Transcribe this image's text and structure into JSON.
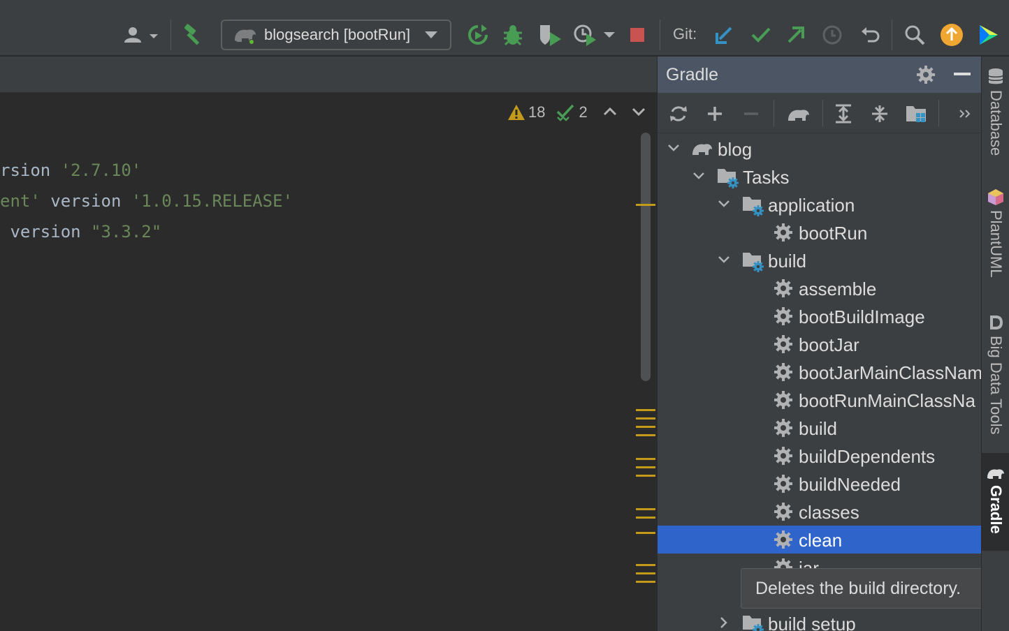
{
  "toolbar": {
    "run_config": "blogsearch [bootRun]",
    "git_label": "Git:"
  },
  "editor": {
    "lines": [
      {
        "pre": "rsion ",
        "str": "'2.7.10'",
        "post": ""
      },
      {
        "pre": "",
        "str": "ent'",
        "mid": " version ",
        "str2": "'1.0.15.RELEASE'"
      },
      {
        "pre": " version ",
        "str": "\"3.3.2\"",
        "post": ""
      }
    ],
    "warnings_count": "18",
    "checks_count": "2"
  },
  "gradle": {
    "title": "Gradle",
    "tree": [
      {
        "label": "blog",
        "indent": 0,
        "chevron": "down",
        "icon": "elephant"
      },
      {
        "label": "Tasks",
        "indent": 1,
        "chevron": "down",
        "icon": "folder-gear"
      },
      {
        "label": "application",
        "indent": 2,
        "chevron": "down",
        "icon": "folder-gear"
      },
      {
        "label": "bootRun",
        "indent": 3,
        "chevron": "none",
        "icon": "gear"
      },
      {
        "label": "build",
        "indent": 2,
        "chevron": "down",
        "icon": "folder-gear"
      },
      {
        "label": "assemble",
        "indent": 3,
        "chevron": "none",
        "icon": "gear"
      },
      {
        "label": "bootBuildImage",
        "indent": 3,
        "chevron": "none",
        "icon": "gear"
      },
      {
        "label": "bootJar",
        "indent": 3,
        "chevron": "none",
        "icon": "gear"
      },
      {
        "label": "bootJarMainClassNam",
        "indent": 3,
        "chevron": "none",
        "icon": "gear"
      },
      {
        "label": "bootRunMainClassNa",
        "indent": 3,
        "chevron": "none",
        "icon": "gear"
      },
      {
        "label": "build",
        "indent": 3,
        "chevron": "none",
        "icon": "gear"
      },
      {
        "label": "buildDependents",
        "indent": 3,
        "chevron": "none",
        "icon": "gear"
      },
      {
        "label": "buildNeeded",
        "indent": 3,
        "chevron": "none",
        "icon": "gear"
      },
      {
        "label": "classes",
        "indent": 3,
        "chevron": "none",
        "icon": "gear"
      },
      {
        "label": "clean",
        "indent": 3,
        "chevron": "none",
        "icon": "gear",
        "selected": true
      },
      {
        "label": "jar",
        "indent": 3,
        "chevron": "none",
        "icon": "gear"
      },
      {
        "label": "",
        "indent": 3,
        "chevron": "none",
        "icon": "none"
      },
      {
        "label": "build setup",
        "indent": 2,
        "chevron": "right",
        "icon": "folder-gear"
      }
    ],
    "tooltip": "Deletes the build directory."
  },
  "side_tabs": [
    {
      "label": "Database",
      "icon": "database-icon"
    },
    {
      "label": "PlantUML",
      "icon": "plantuml-icon"
    },
    {
      "label": "Big Data Tools",
      "icon": "big-data-tools-icon"
    },
    {
      "label": "Gradle",
      "icon": "gradle-elephant-icon",
      "active": true
    }
  ],
  "colors": {
    "accent_selected": "#2f65ca",
    "run_green": "#499c54",
    "stop_red": "#c75450",
    "git_blue": "#3592c4",
    "warning_yellow": "#c49a1b",
    "update_orange": "#f0a732"
  }
}
